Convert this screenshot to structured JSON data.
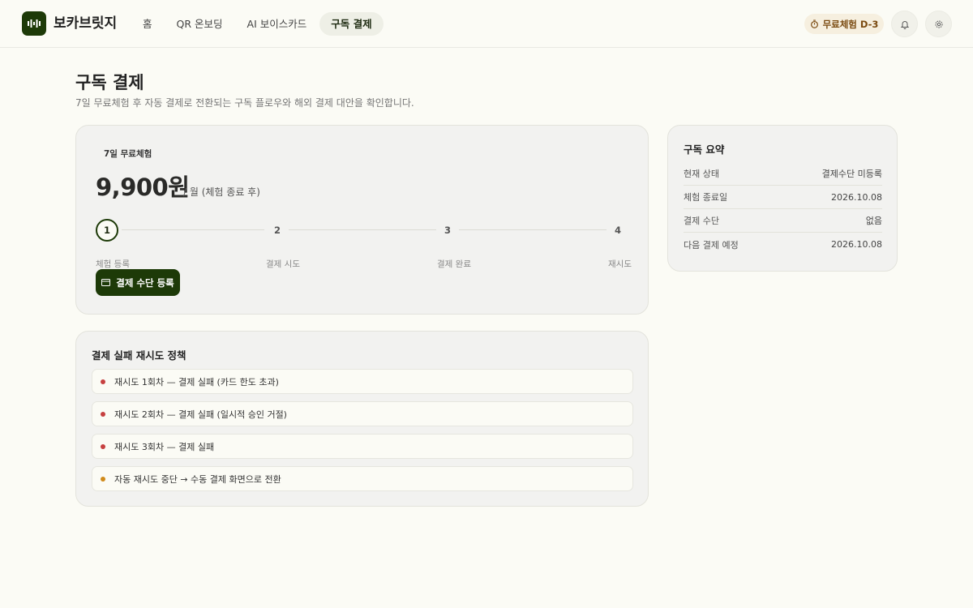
{
  "colors": {
    "brand": "#1d3a08",
    "fail_dot": "#c64040",
    "warn_dot": "#d08a1a",
    "trial_text": "#7a4a10"
  },
  "header": {
    "brand": "보카브릿지",
    "nav": [
      {
        "label": "홈",
        "active": false
      },
      {
        "label": "QR 온보딩",
        "active": false
      },
      {
        "label": "AI 보이스카드",
        "active": false
      },
      {
        "label": "구독 결제",
        "active": true
      }
    ],
    "trial_badge": "무료체험 D-3",
    "icons": [
      "logo-waveform-icon",
      "timer-icon",
      "bell-icon",
      "gear-icon"
    ]
  },
  "page": {
    "title": "구독 결제",
    "subtitle": "7일 무료체험 후 자동 결제로 전환되는 구독 플로우와 해외 결제 대안을 확인합니다."
  },
  "plan": {
    "badge": "7일 무료체험",
    "price": "9,900원",
    "unit": "/ 월 (체험 종료 후)",
    "current_step": 1,
    "steps": [
      {
        "number": "1",
        "label": "체험 등록"
      },
      {
        "number": "2",
        "label": "결제 시도"
      },
      {
        "number": "3",
        "label": "결제 완료"
      },
      {
        "number": "4",
        "label": "재시도"
      }
    ],
    "cta_label": "결제 수단 등록",
    "cta_icon": "credit-card-icon"
  },
  "summary": {
    "title": "구독 요약",
    "rows": [
      {
        "key": "현재 상태",
        "value": "결제수단 미등록"
      },
      {
        "key": "체험 종료일",
        "value": "2026.10.08"
      },
      {
        "key": "결제 수단",
        "value": "없음"
      },
      {
        "key": "다음 결제 예정",
        "value": "2026.10.08"
      }
    ]
  },
  "retry": {
    "title": "결제 실패 재시도 정책",
    "items": [
      {
        "text": "재시도 1회차 — 결제 실패 (카드 한도 초과)",
        "status": "fail"
      },
      {
        "text": "재시도 2회차 — 결제 실패 (일시적 승인 거절)",
        "status": "fail"
      },
      {
        "text": "재시도 3회차 — 결제 실패",
        "status": "fail"
      },
      {
        "text": "자동 재시도 중단 → 수동 결제 화면으로 전환",
        "status": "warn"
      }
    ]
  }
}
